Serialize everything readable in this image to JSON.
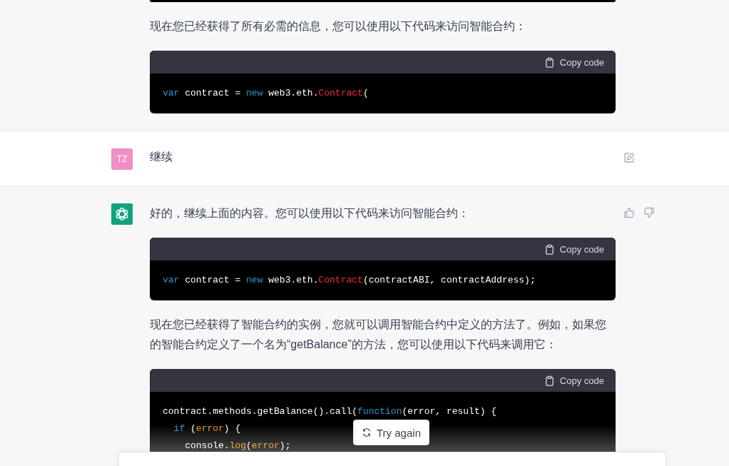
{
  "messages": [
    {
      "kind": "continuation",
      "blocks": [
        {
          "kind": "code-end"
        },
        {
          "kind": "text",
          "text": "现在您已经获得了所有必需的信息，您可以使用以下代码来访问智能合约："
        },
        {
          "kind": "code",
          "copy_label": "Copy code",
          "lines": [
            [
              {
                "t": "var",
                "kind": "keyword"
              },
              {
                "t": " contract = ",
                "kind": "plain"
              },
              {
                "t": "new",
                "kind": "keyword"
              },
              {
                "t": " web3.eth.",
                "kind": "plain"
              },
              {
                "t": "Contract",
                "kind": "class"
              },
              {
                "t": "(",
                "kind": "plain"
              }
            ]
          ]
        }
      ]
    },
    {
      "kind": "user",
      "avatar": "TZ",
      "blocks": [
        {
          "kind": "text",
          "text": "继续"
        }
      ]
    },
    {
      "kind": "assistant",
      "blocks": [
        {
          "kind": "text",
          "text": "好的，继续上面的内容。您可以使用以下代码来访问智能合约："
        },
        {
          "kind": "code",
          "copy_label": "Copy code",
          "lines": [
            [
              {
                "t": "var",
                "kind": "keyword"
              },
              {
                "t": " contract = ",
                "kind": "plain"
              },
              {
                "t": "new",
                "kind": "keyword"
              },
              {
                "t": " web3.eth.",
                "kind": "plain"
              },
              {
                "t": "Contract",
                "kind": "class"
              },
              {
                "t": "(contractABI, contractAddress);",
                "kind": "plain"
              }
            ]
          ]
        },
        {
          "kind": "text",
          "text": "现在您已经获得了智能合约的实例，您就可以调用智能合约中定义的方法了。例如，如果您的智能合约定义了一个名为“getBalance”的方法，您可以使用以下代码来调用它："
        },
        {
          "kind": "code",
          "copy_label": "Copy code",
          "lines": [
            [
              {
                "t": "contract.methods.getBalance().call(",
                "kind": "plain"
              },
              {
                "t": "function",
                "kind": "keyword"
              },
              {
                "t": "(error, result) {",
                "kind": "plain"
              }
            ],
            [
              {
                "t": "  if",
                "kind": "keyword"
              },
              {
                "t": " (",
                "kind": "plain"
              },
              {
                "t": "error",
                "kind": "param"
              },
              {
                "t": ") {",
                "kind": "plain"
              }
            ],
            [
              {
                "t": "    console.",
                "kind": "plain"
              },
              {
                "t": "log",
                "kind": "param"
              },
              {
                "t": "(",
                "kind": "plain"
              },
              {
                "t": "error",
                "kind": "param"
              },
              {
                "t": ");",
                "kind": "plain"
              }
            ]
          ]
        }
      ]
    }
  ],
  "retry_button": "Try again"
}
